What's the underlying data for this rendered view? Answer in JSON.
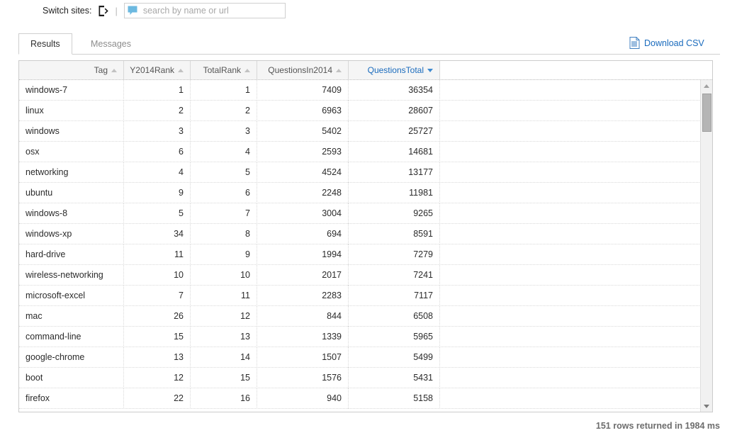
{
  "topbar": {
    "switch_label": "Switch sites:",
    "site_logo_icon": "stack-exchange-logo-icon",
    "divider": "|",
    "search": {
      "placeholder": "search by name or url",
      "value": "",
      "icon": "chat-bubble-icon"
    }
  },
  "tabs": [
    {
      "label": "Results",
      "active": true
    },
    {
      "label": "Messages",
      "active": false
    }
  ],
  "download": {
    "label": "Download CSV",
    "icon": "csv-document-icon",
    "color": "#1a6bbd"
  },
  "table": {
    "columns": [
      {
        "label": "Tag",
        "sort": "asc",
        "active": false,
        "align": "txt"
      },
      {
        "label": "Y2014Rank",
        "sort": "asc",
        "active": false,
        "align": "num"
      },
      {
        "label": "TotalRank",
        "sort": "asc",
        "active": false,
        "align": "num"
      },
      {
        "label": "QuestionsIn2014",
        "sort": "asc",
        "active": false,
        "align": "num"
      },
      {
        "label": "QuestionsTotal",
        "sort": "desc",
        "active": true,
        "align": "num"
      }
    ],
    "rows": [
      [
        "windows-7",
        "1",
        "1",
        "7409",
        "36354"
      ],
      [
        "linux",
        "2",
        "2",
        "6963",
        "28607"
      ],
      [
        "windows",
        "3",
        "3",
        "5402",
        "25727"
      ],
      [
        "osx",
        "6",
        "4",
        "2593",
        "14681"
      ],
      [
        "networking",
        "4",
        "5",
        "4524",
        "13177"
      ],
      [
        "ubuntu",
        "9",
        "6",
        "2248",
        "11981"
      ],
      [
        "windows-8",
        "5",
        "7",
        "3004",
        "9265"
      ],
      [
        "windows-xp",
        "34",
        "8",
        "694",
        "8591"
      ],
      [
        "hard-drive",
        "11",
        "9",
        "1994",
        "7279"
      ],
      [
        "wireless-networking",
        "10",
        "10",
        "2017",
        "7241"
      ],
      [
        "microsoft-excel",
        "7",
        "11",
        "2283",
        "7117"
      ],
      [
        "mac",
        "26",
        "12",
        "844",
        "6508"
      ],
      [
        "command-line",
        "15",
        "13",
        "1339",
        "5965"
      ],
      [
        "google-chrome",
        "13",
        "14",
        "1507",
        "5499"
      ],
      [
        "boot",
        "12",
        "15",
        "1576",
        "5431"
      ],
      [
        "firefox",
        "22",
        "16",
        "940",
        "5158"
      ]
    ]
  },
  "status": {
    "text": "151 rows returned in 1984 ms"
  }
}
